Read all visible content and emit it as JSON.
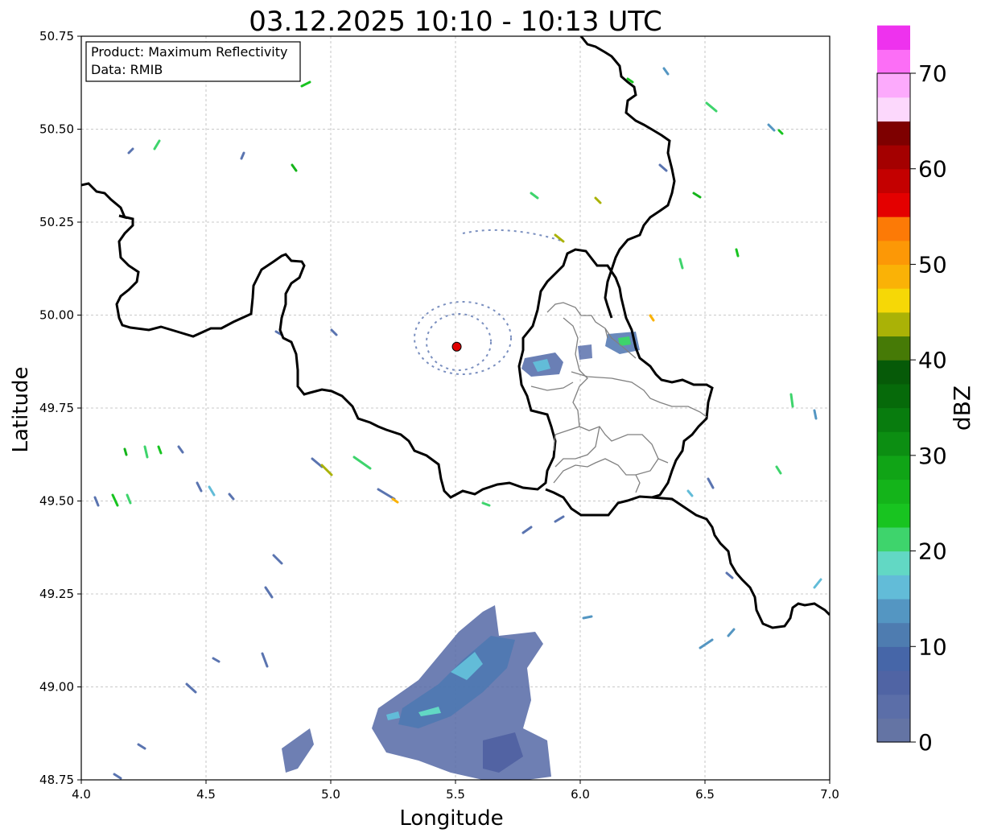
{
  "title": "03.12.2025 10:10 - 10:13 UTC",
  "info": {
    "product": "Product: Maximum Reflectivity",
    "source": "Data: RMIB"
  },
  "axes": {
    "xlabel": "Longitude",
    "ylabel": "Latitude",
    "xlim": [
      4.0,
      7.0
    ],
    "ylim": [
      48.75,
      50.75
    ],
    "xticks": [
      "4.0",
      "4.5",
      "5.0",
      "5.5",
      "6.0",
      "6.5",
      "7.0"
    ],
    "yticks": [
      "48.75",
      "49.00",
      "49.25",
      "49.50",
      "49.75",
      "50.00",
      "50.25",
      "50.50",
      "50.75"
    ],
    "grid": true
  },
  "radar_site": {
    "lon": 5.505,
    "lat": 49.915,
    "color": "#e00000"
  },
  "colorbar": {
    "label": "dBZ",
    "min": 0,
    "max": 70,
    "step": 2.5,
    "ticks": [
      "0",
      "10",
      "20",
      "30",
      "40",
      "50",
      "60",
      "70"
    ],
    "colors": [
      "#6474a4",
      "#5b6ea8",
      "#5064a4",
      "#4666a8",
      "#4e7cb0",
      "#5496c2",
      "#62bcd8",
      "#62d8c4",
      "#3ed46c",
      "#18c420",
      "#14b41a",
      "#10a416",
      "#0c8e12",
      "#087c0e",
      "#066a0a",
      "#065a08",
      "#467a06",
      "#aab206",
      "#f6d806",
      "#fab206",
      "#fc9806",
      "#fc7a06",
      "#e40000",
      "#c40000",
      "#a40000",
      "#7e0000",
      "#fcd8fc",
      "#fcaafc",
      "#fc6ef6",
      "#ee32ee"
    ]
  }
}
